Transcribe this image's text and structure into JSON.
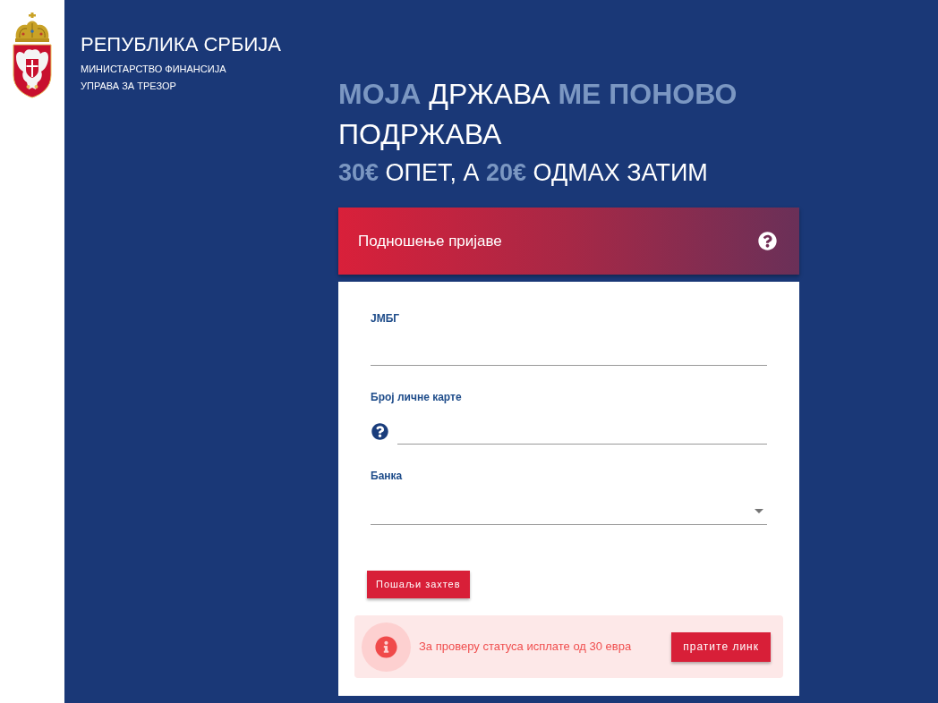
{
  "header": {
    "title": "РЕПУБЛИКА СРБИЈА",
    "subtitle_lines": [
      "МИНИСТАРСТВО ФИНАНСИЈА",
      "УПРАВА ЗА ТРЕЗОР"
    ]
  },
  "headline": "**МОЈА** ДРЖАВА **МЕ ПОНОВО** ПОДРЖАВА",
  "subheadline": "**30€** ОПЕТ, А **20€** ОДМАХ ЗАТИМ",
  "form": {
    "title": "Подношење пријаве",
    "fields": [
      {
        "kind": "text",
        "label": "ЈМБГ",
        "help": false
      },
      {
        "kind": "text",
        "label": "Број личне карте",
        "help": true
      },
      {
        "kind": "select",
        "label": "Банка",
        "help": false
      }
    ],
    "submit": "Пошаљи захтев",
    "notice": {
      "text": "За проверу статуса исплате од 30 евра",
      "link": "пратите линк"
    }
  }
}
